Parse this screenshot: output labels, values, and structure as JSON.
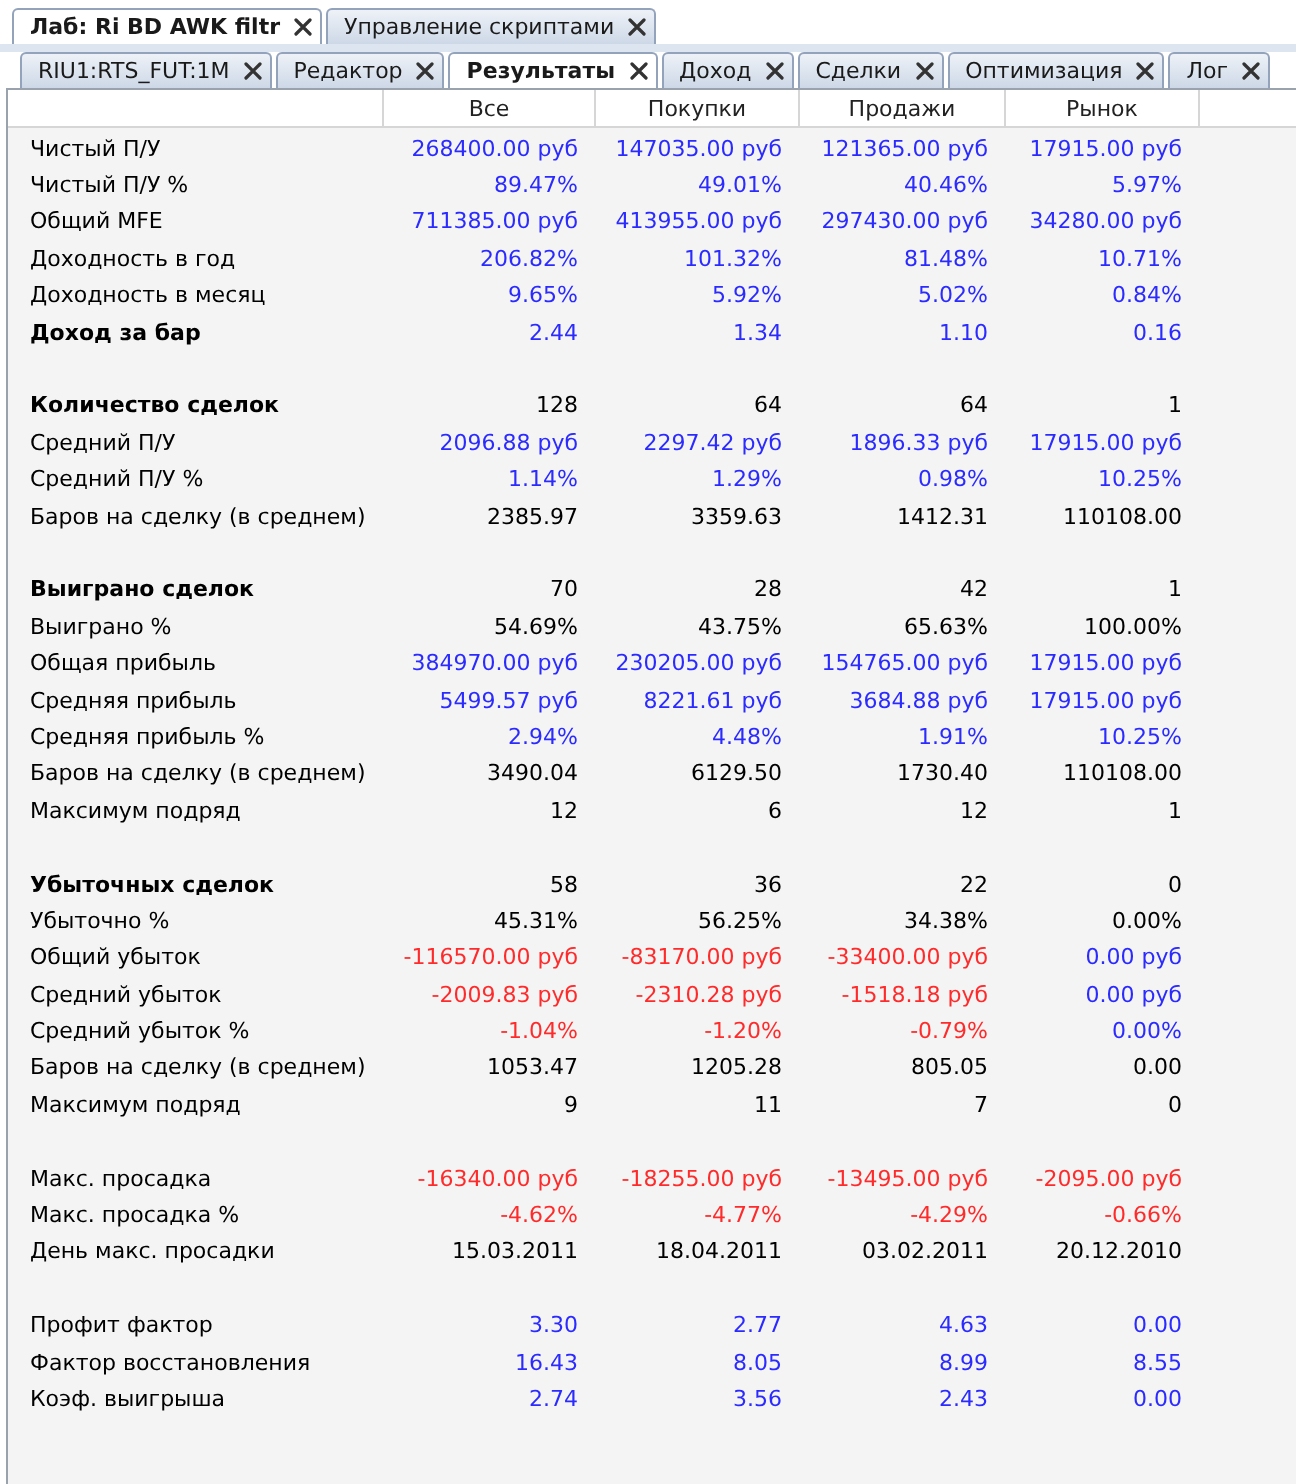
{
  "tabs": [
    {
      "label": "Лаб: Ri BD AWK filtr",
      "selected": true
    },
    {
      "label": "Управление скриптами",
      "selected": false
    }
  ],
  "subtabs": [
    {
      "label": "RIU1:RTS_FUT:1M",
      "selected": false
    },
    {
      "label": "Редактор",
      "selected": false
    },
    {
      "label": "Результаты",
      "selected": true
    },
    {
      "label": "Доход",
      "selected": false
    },
    {
      "label": "Сделки",
      "selected": false
    },
    {
      "label": "Оптимизация",
      "selected": false
    },
    {
      "label": "Лог",
      "selected": false
    }
  ],
  "table": {
    "columns": [
      "Все",
      "Покупки",
      "Продажи",
      "Рынок"
    ],
    "sections": [
      {
        "rows": [
          {
            "label": "Чистый П/У",
            "bold": false,
            "values": [
              {
                "text": "268400.00 руб",
                "color": "#2b2bff"
              },
              {
                "text": "147035.00 руб",
                "color": "#2b2bff"
              },
              {
                "text": "121365.00 руб",
                "color": "#2b2bff"
              },
              {
                "text": "17915.00 руб",
                "color": "#2b2bff"
              }
            ]
          },
          {
            "label": "Чистый П/У %",
            "bold": false,
            "values": [
              {
                "text": "89.47%",
                "color": "#2b2bff"
              },
              {
                "text": "49.01%",
                "color": "#2b2bff"
              },
              {
                "text": "40.46%",
                "color": "#2b2bff"
              },
              {
                "text": "5.97%",
                "color": "#2b2bff"
              }
            ]
          },
          {
            "label": "Общий MFE",
            "bold": false,
            "values": [
              {
                "text": "711385.00 руб",
                "color": "#2b2bff"
              },
              {
                "text": "413955.00 руб",
                "color": "#2b2bff"
              },
              {
                "text": "297430.00 руб",
                "color": "#2b2bff"
              },
              {
                "text": "34280.00 руб",
                "color": "#2b2bff"
              }
            ]
          },
          {
            "label": "Доходность в год",
            "bold": false,
            "values": [
              {
                "text": "206.82%",
                "color": "#2b2bff"
              },
              {
                "text": "101.32%",
                "color": "#2b2bff"
              },
              {
                "text": "81.48%",
                "color": "#2b2bff"
              },
              {
                "text": "10.71%",
                "color": "#2b2bff"
              }
            ]
          },
          {
            "label": "Доходность в месяц",
            "bold": false,
            "values": [
              {
                "text": "9.65%",
                "color": "#2b2bff"
              },
              {
                "text": "5.92%",
                "color": "#2b2bff"
              },
              {
                "text": "5.02%",
                "color": "#2b2bff"
              },
              {
                "text": "0.84%",
                "color": "#2b2bff"
              }
            ]
          },
          {
            "label": "Доход за бар",
            "bold": true,
            "values": [
              {
                "text": "2.44",
                "color": "#2b2bff"
              },
              {
                "text": "1.34",
                "color": "#2b2bff"
              },
              {
                "text": "1.10",
                "color": "#2b2bff"
              },
              {
                "text": "0.16",
                "color": "#2b2bff"
              }
            ]
          }
        ]
      },
      {
        "rows": [
          {
            "label": "Количество сделок",
            "bold": true,
            "values": [
              {
                "text": "128",
                "color": "#000000"
              },
              {
                "text": "64",
                "color": "#000000"
              },
              {
                "text": "64",
                "color": "#000000"
              },
              {
                "text": "1",
                "color": "#000000"
              }
            ]
          },
          {
            "label": "Средний П/У",
            "bold": false,
            "values": [
              {
                "text": "2096.88 руб",
                "color": "#2b2bff"
              },
              {
                "text": "2297.42 руб",
                "color": "#2b2bff"
              },
              {
                "text": "1896.33 руб",
                "color": "#2b2bff"
              },
              {
                "text": "17915.00 руб",
                "color": "#2b2bff"
              }
            ]
          },
          {
            "label": "Средний П/У %",
            "bold": false,
            "values": [
              {
                "text": "1.14%",
                "color": "#2b2bff"
              },
              {
                "text": "1.29%",
                "color": "#2b2bff"
              },
              {
                "text": "0.98%",
                "color": "#2b2bff"
              },
              {
                "text": "10.25%",
                "color": "#2b2bff"
              }
            ]
          },
          {
            "label": "Баров на сделку (в среднем)",
            "bold": false,
            "values": [
              {
                "text": "2385.97",
                "color": "#000000"
              },
              {
                "text": "3359.63",
                "color": "#000000"
              },
              {
                "text": "1412.31",
                "color": "#000000"
              },
              {
                "text": "110108.00",
                "color": "#000000"
              }
            ]
          }
        ]
      },
      {
        "rows": [
          {
            "label": "Выиграно сделок",
            "bold": true,
            "values": [
              {
                "text": "70",
                "color": "#000000"
              },
              {
                "text": "28",
                "color": "#000000"
              },
              {
                "text": "42",
                "color": "#000000"
              },
              {
                "text": "1",
                "color": "#000000"
              }
            ]
          },
          {
            "label": "Выиграно %",
            "bold": false,
            "values": [
              {
                "text": "54.69%",
                "color": "#000000"
              },
              {
                "text": "43.75%",
                "color": "#000000"
              },
              {
                "text": "65.63%",
                "color": "#000000"
              },
              {
                "text": "100.00%",
                "color": "#000000"
              }
            ]
          },
          {
            "label": "Общая прибыль",
            "bold": false,
            "values": [
              {
                "text": "384970.00 руб",
                "color": "#2b2bff"
              },
              {
                "text": "230205.00 руб",
                "color": "#2b2bff"
              },
              {
                "text": "154765.00 руб",
                "color": "#2b2bff"
              },
              {
                "text": "17915.00 руб",
                "color": "#2b2bff"
              }
            ]
          },
          {
            "label": "Средняя прибыль",
            "bold": false,
            "values": [
              {
                "text": "5499.57 руб",
                "color": "#2b2bff"
              },
              {
                "text": "8221.61 руб",
                "color": "#2b2bff"
              },
              {
                "text": "3684.88 руб",
                "color": "#2b2bff"
              },
              {
                "text": "17915.00 руб",
                "color": "#2b2bff"
              }
            ]
          },
          {
            "label": "Средняя прибыль %",
            "bold": false,
            "values": [
              {
                "text": "2.94%",
                "color": "#2b2bff"
              },
              {
                "text": "4.48%",
                "color": "#2b2bff"
              },
              {
                "text": "1.91%",
                "color": "#2b2bff"
              },
              {
                "text": "10.25%",
                "color": "#2b2bff"
              }
            ]
          },
          {
            "label": "Баров на сделку (в среднем)",
            "bold": false,
            "values": [
              {
                "text": "3490.04",
                "color": "#000000"
              },
              {
                "text": "6129.50",
                "color": "#000000"
              },
              {
                "text": "1730.40",
                "color": "#000000"
              },
              {
                "text": "110108.00",
                "color": "#000000"
              }
            ]
          },
          {
            "label": "Максимум подряд",
            "bold": false,
            "values": [
              {
                "text": "12",
                "color": "#000000"
              },
              {
                "text": "6",
                "color": "#000000"
              },
              {
                "text": "12",
                "color": "#000000"
              },
              {
                "text": "1",
                "color": "#000000"
              }
            ]
          }
        ]
      },
      {
        "rows": [
          {
            "label": "Убыточных сделок",
            "bold": true,
            "values": [
              {
                "text": "58",
                "color": "#000000"
              },
              {
                "text": "36",
                "color": "#000000"
              },
              {
                "text": "22",
                "color": "#000000"
              },
              {
                "text": "0",
                "color": "#000000"
              }
            ]
          },
          {
            "label": "Убыточно %",
            "bold": false,
            "values": [
              {
                "text": "45.31%",
                "color": "#000000"
              },
              {
                "text": "56.25%",
                "color": "#000000"
              },
              {
                "text": "34.38%",
                "color": "#000000"
              },
              {
                "text": "0.00%",
                "color": "#000000"
              }
            ]
          },
          {
            "label": "Общий убыток",
            "bold": false,
            "values": [
              {
                "text": "-116570.00 руб",
                "color": "#ff2b2b"
              },
              {
                "text": "-83170.00 руб",
                "color": "#ff2b2b"
              },
              {
                "text": "-33400.00 руб",
                "color": "#ff2b2b"
              },
              {
                "text": "0.00 руб",
                "color": "#2b2bff"
              }
            ]
          },
          {
            "label": "Средний убыток",
            "bold": false,
            "values": [
              {
                "text": "-2009.83 руб",
                "color": "#ff2b2b"
              },
              {
                "text": "-2310.28 руб",
                "color": "#ff2b2b"
              },
              {
                "text": "-1518.18 руб",
                "color": "#ff2b2b"
              },
              {
                "text": "0.00 руб",
                "color": "#2b2bff"
              }
            ]
          },
          {
            "label": "Средний убыток %",
            "bold": false,
            "values": [
              {
                "text": "-1.04%",
                "color": "#ff2b2b"
              },
              {
                "text": "-1.20%",
                "color": "#ff2b2b"
              },
              {
                "text": "-0.79%",
                "color": "#ff2b2b"
              },
              {
                "text": "0.00%",
                "color": "#2b2bff"
              }
            ]
          },
          {
            "label": "Баров на сделку (в среднем)",
            "bold": false,
            "values": [
              {
                "text": "1053.47",
                "color": "#000000"
              },
              {
                "text": "1205.28",
                "color": "#000000"
              },
              {
                "text": "805.05",
                "color": "#000000"
              },
              {
                "text": "0.00",
                "color": "#000000"
              }
            ]
          },
          {
            "label": "Максимум подряд",
            "bold": false,
            "values": [
              {
                "text": "9",
                "color": "#000000"
              },
              {
                "text": "11",
                "color": "#000000"
              },
              {
                "text": "7",
                "color": "#000000"
              },
              {
                "text": "0",
                "color": "#000000"
              }
            ]
          }
        ]
      },
      {
        "rows": [
          {
            "label": "Макс. просадка",
            "bold": false,
            "values": [
              {
                "text": "-16340.00 руб",
                "color": "#ff2b2b"
              },
              {
                "text": "-18255.00 руб",
                "color": "#ff2b2b"
              },
              {
                "text": "-13495.00 руб",
                "color": "#ff2b2b"
              },
              {
                "text": "-2095.00 руб",
                "color": "#ff2b2b"
              }
            ]
          },
          {
            "label": "Макс. просадка %",
            "bold": false,
            "values": [
              {
                "text": "-4.62%",
                "color": "#ff2b2b"
              },
              {
                "text": "-4.77%",
                "color": "#ff2b2b"
              },
              {
                "text": "-4.29%",
                "color": "#ff2b2b"
              },
              {
                "text": "-0.66%",
                "color": "#ff2b2b"
              }
            ]
          },
          {
            "label": "День макс. просадки",
            "bold": false,
            "values": [
              {
                "text": "15.03.2011",
                "color": "#000000"
              },
              {
                "text": "18.04.2011",
                "color": "#000000"
              },
              {
                "text": "03.02.2011",
                "color": "#000000"
              },
              {
                "text": "20.12.2010",
                "color": "#000000"
              }
            ]
          }
        ]
      },
      {
        "rows": [
          {
            "label": "Профит фактор",
            "bold": false,
            "values": [
              {
                "text": "3.30",
                "color": "#2b2bff"
              },
              {
                "text": "2.77",
                "color": "#2b2bff"
              },
              {
                "text": "4.63",
                "color": "#2b2bff"
              },
              {
                "text": "0.00",
                "color": "#2b2bff"
              }
            ]
          },
          {
            "label": "Фактор восстановления",
            "bold": false,
            "values": [
              {
                "text": "16.43",
                "color": "#2b2bff"
              },
              {
                "text": "8.05",
                "color": "#2b2bff"
              },
              {
                "text": "8.99",
                "color": "#2b2bff"
              },
              {
                "text": "8.55",
                "color": "#2b2bff"
              }
            ]
          },
          {
            "label": "Коэф. выигрыша",
            "bold": false,
            "values": [
              {
                "text": "2.74",
                "color": "#2b2bff"
              },
              {
                "text": "3.56",
                "color": "#2b2bff"
              },
              {
                "text": "2.43",
                "color": "#2b2bff"
              },
              {
                "text": "0.00",
                "color": "#2b2bff"
              }
            ]
          }
        ]
      }
    ]
  }
}
